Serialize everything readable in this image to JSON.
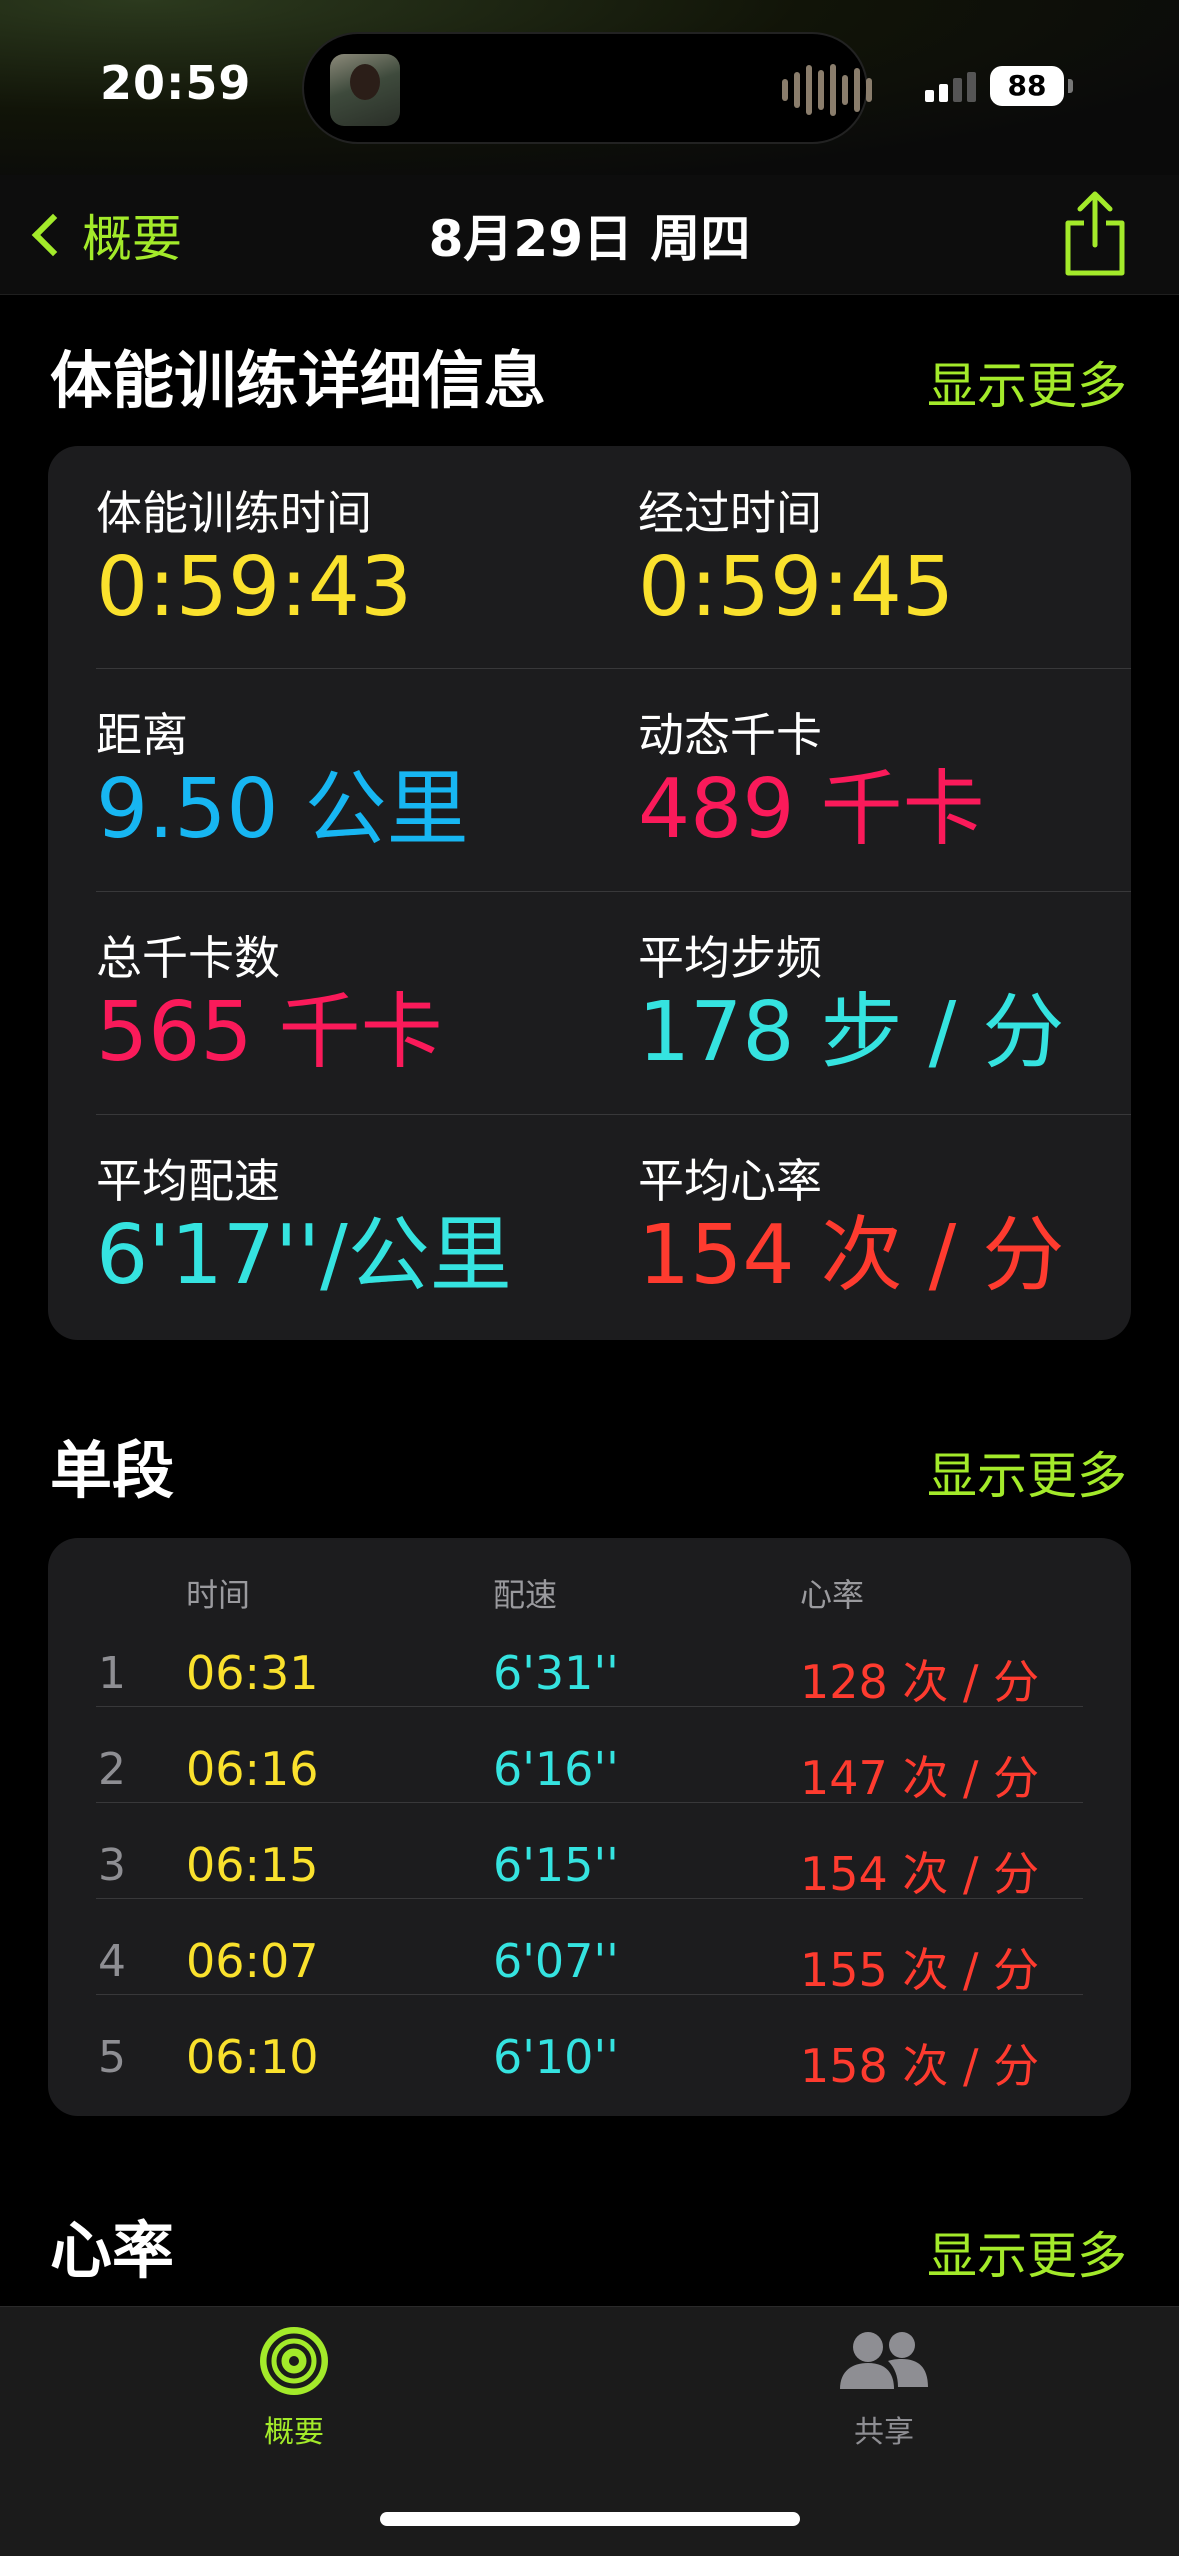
{
  "status": {
    "time": "20:59",
    "battery": "88"
  },
  "nav": {
    "back_label": "概要",
    "title": "8月29日 周四"
  },
  "details": {
    "title": "体能训练详细信息",
    "show_more": "显示更多",
    "metrics": [
      {
        "label": "体能训练时间",
        "value": "0:59:43",
        "color": "#fae12d"
      },
      {
        "label": "经过时间",
        "value": "0:59:45",
        "color": "#fae12d"
      },
      {
        "label": "距离",
        "value": "9.50 公里",
        "color": "#17b6f2"
      },
      {
        "label": "动态千卡",
        "value": "489 千卡",
        "color": "#fa1a5a"
      },
      {
        "label": "总千卡数",
        "value": "565 千卡",
        "color": "#fa1a5a"
      },
      {
        "label": "平均步频",
        "value": "178 步 / 分",
        "color": "#35e3e0"
      },
      {
        "label": "平均配速",
        "value": "6'17''/公里",
        "color": "#35e3e0"
      },
      {
        "label": "平均心率",
        "value": "154 次 / 分",
        "color": "#fe3b2f"
      }
    ]
  },
  "splits": {
    "title": "单段",
    "show_more": "显示更多",
    "headers": {
      "time": "时间",
      "pace": "配速",
      "heart_rate": "心率"
    },
    "rows": [
      {
        "index": "1",
        "time": "06:31",
        "pace": "6'31''",
        "heart_rate": "128 次 / 分"
      },
      {
        "index": "2",
        "time": "06:16",
        "pace": "6'16''",
        "heart_rate": "147 次 / 分"
      },
      {
        "index": "3",
        "time": "06:15",
        "pace": "6'15''",
        "heart_rate": "154 次 / 分"
      },
      {
        "index": "4",
        "time": "06:07",
        "pace": "6'07''",
        "heart_rate": "155 次 / 分"
      },
      {
        "index": "5",
        "time": "06:10",
        "pace": "6'10''",
        "heart_rate": "158 次 / 分"
      }
    ]
  },
  "heart_rate_section": {
    "title": "心率",
    "show_more": "显示更多"
  },
  "tabbar": {
    "items": [
      {
        "label": "概要",
        "icon": "activity-rings-icon",
        "active": true
      },
      {
        "label": "共享",
        "icon": "people-icon",
        "active": false
      }
    ]
  }
}
